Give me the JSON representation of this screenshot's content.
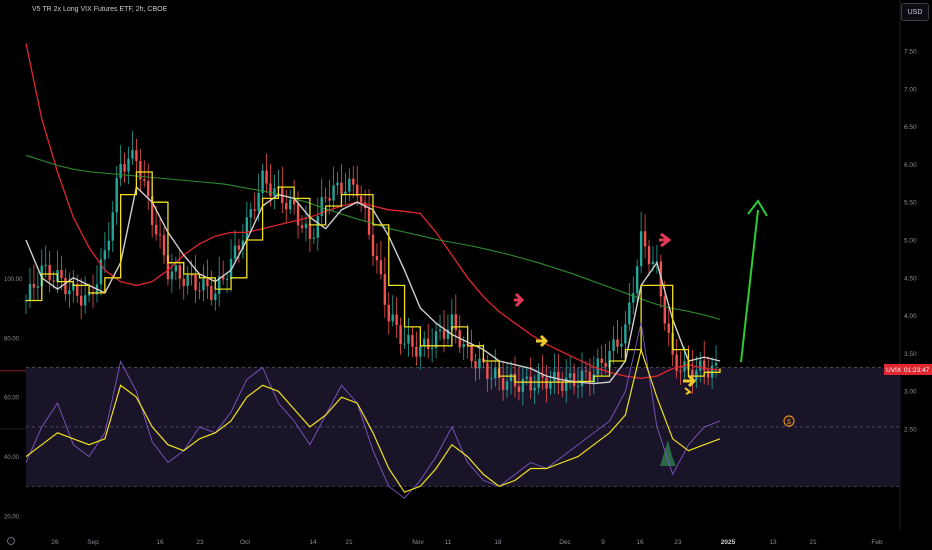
{
  "header": {
    "title": "V5 TR 2x Long VIX Futures ETF, 2h, CBOE",
    "currency": "USD"
  },
  "price_tag": {
    "symbol": "UVIX",
    "time": "01:23:47"
  },
  "event_badge": "$",
  "colors": {
    "background": "#000000",
    "ema_red": "#e0262f",
    "ma_green": "#2e8b2e",
    "ma_gray": "#cfcfcf",
    "ma_yellow": "#f0e020",
    "up_candle": "#26a69a",
    "down_candle": "#ef5350",
    "rsi_line": "#7e57c2",
    "rsi_ma": "#f0e020",
    "rsi_band": "#1a1428",
    "arrow_green": "#2ecc2e",
    "arrow_red": "#e33a58",
    "arrow_yellow": "#f0c830",
    "badge": "#e08a1e"
  },
  "chart_data": [
    {
      "type": "candlestick",
      "title": "V5 TR 2x Long VIX Futures ETF, 2h, CBOE",
      "x_ticks": [
        "26",
        "Sep",
        "16",
        "23",
        "Oct",
        "14",
        "21",
        "Nov",
        "11",
        "18",
        "Dec",
        "9",
        "16",
        "23",
        "2025",
        "13",
        "21",
        "Feb"
      ],
      "y_ticks": [
        "7.50",
        "7.00",
        "6.50",
        "6.00",
        "5.50",
        "5.00",
        "4.50",
        "4.00",
        "3.50",
        "3.00",
        "2.50"
      ],
      "ylim": [
        2.5,
        7.75
      ],
      "last_price": 3.27,
      "series": [
        {
          "name": "ema_red",
          "values": [
            7.6,
            6.6,
            5.9,
            5.3,
            4.9,
            4.6,
            4.45,
            4.4,
            4.45,
            4.6,
            4.8,
            4.95,
            5.05,
            5.1,
            5.1,
            5.15,
            5.2,
            5.25,
            5.3,
            5.38,
            5.45,
            5.5,
            5.45,
            5.4,
            5.38,
            5.35,
            5.1,
            4.8,
            4.5,
            4.25,
            4.05,
            3.9,
            3.75,
            3.62,
            3.52,
            3.42,
            3.32,
            3.25,
            3.2,
            3.17,
            3.2,
            3.3,
            3.35,
            3.3,
            3.28
          ]
        },
        {
          "name": "ma_green",
          "values": [
            6.12,
            6.05,
            5.98,
            5.93,
            5.9,
            5.88,
            5.86,
            5.84,
            5.82,
            5.8,
            5.78,
            5.76,
            5.74,
            5.7,
            5.66,
            5.62,
            5.56,
            5.5,
            5.42,
            5.35,
            5.28,
            5.22,
            5.15,
            5.1,
            5.05,
            5.0,
            4.96,
            4.92,
            4.87,
            4.82,
            4.76,
            4.7,
            4.63,
            4.56,
            4.48,
            4.4,
            4.32,
            4.24,
            4.16,
            4.1,
            4.06,
            4.01,
            3.95
          ]
        },
        {
          "name": "ma_gray",
          "values": [
            5.0,
            4.5,
            4.35,
            4.5,
            4.4,
            4.3,
            4.7,
            5.7,
            5.5,
            5.1,
            4.8,
            4.55,
            4.45,
            4.6,
            5.0,
            5.45,
            5.6,
            5.55,
            5.3,
            5.15,
            5.4,
            5.5,
            5.4,
            5.05,
            4.6,
            4.1,
            3.9,
            3.75,
            3.65,
            3.55,
            3.4,
            3.35,
            3.3,
            3.2,
            3.15,
            3.12,
            3.1,
            3.12,
            3.4,
            4.4,
            4.7,
            3.95,
            3.4,
            3.45,
            3.4
          ]
        },
        {
          "name": "ma_yellow",
          "values": [
            4.2,
            4.55,
            4.45,
            4.4,
            4.3,
            4.5,
            5.6,
            5.9,
            5.5,
            4.7,
            4.55,
            4.5,
            4.35,
            4.5,
            5.0,
            5.55,
            5.7,
            5.55,
            5.2,
            5.45,
            5.6,
            5.6,
            5.2,
            4.4,
            3.85,
            3.6,
            3.6,
            3.85,
            3.6,
            3.4,
            3.2,
            3.12,
            3.12,
            3.12,
            3.12,
            3.13,
            3.2,
            3.4,
            3.55,
            4.4,
            4.4,
            3.55,
            3.2,
            3.25,
            3.3
          ]
        },
        {
          "name": "close",
          "values": [
            4.2,
            4.6,
            4.5,
            4.3,
            4.2,
            4.8,
            6.0,
            6.1,
            5.3,
            4.6,
            4.5,
            4.4,
            4.3,
            4.7,
            5.2,
            5.8,
            5.6,
            5.4,
            5.0,
            5.6,
            5.7,
            5.7,
            4.9,
            4.0,
            3.65,
            3.55,
            3.7,
            3.9,
            3.5,
            3.3,
            3.15,
            3.1,
            3.1,
            3.15,
            3.12,
            3.15,
            3.25,
            3.5,
            3.8,
            5.0,
            4.6,
            3.4,
            3.25,
            3.3,
            3.27
          ]
        }
      ]
    },
    {
      "type": "line",
      "title": "",
      "y_ticks": [
        "100.00",
        "80.00",
        "60.00",
        "40.00",
        "20.00"
      ],
      "ylim": [
        10,
        100
      ],
      "bands": [
        30,
        50,
        70
      ],
      "series": [
        {
          "name": "rsi",
          "values": [
            38,
            50,
            58,
            44,
            40,
            48,
            72,
            62,
            45,
            38,
            42,
            50,
            48,
            55,
            66,
            70,
            58,
            52,
            44,
            54,
            64,
            58,
            42,
            30,
            26,
            32,
            40,
            50,
            38,
            32,
            30,
            34,
            38,
            36,
            40,
            44,
            48,
            52,
            62,
            85,
            50,
            34,
            44,
            50,
            52
          ]
        },
        {
          "name": "rsi_ma",
          "values": [
            40,
            44,
            48,
            46,
            44,
            46,
            64,
            60,
            50,
            44,
            42,
            46,
            48,
            52,
            60,
            64,
            62,
            56,
            50,
            54,
            60,
            58,
            48,
            36,
            28,
            30,
            36,
            44,
            40,
            34,
            30,
            32,
            36,
            36,
            38,
            40,
            44,
            48,
            54,
            76,
            60,
            46,
            42,
            44,
            46
          ]
        }
      ]
    }
  ]
}
